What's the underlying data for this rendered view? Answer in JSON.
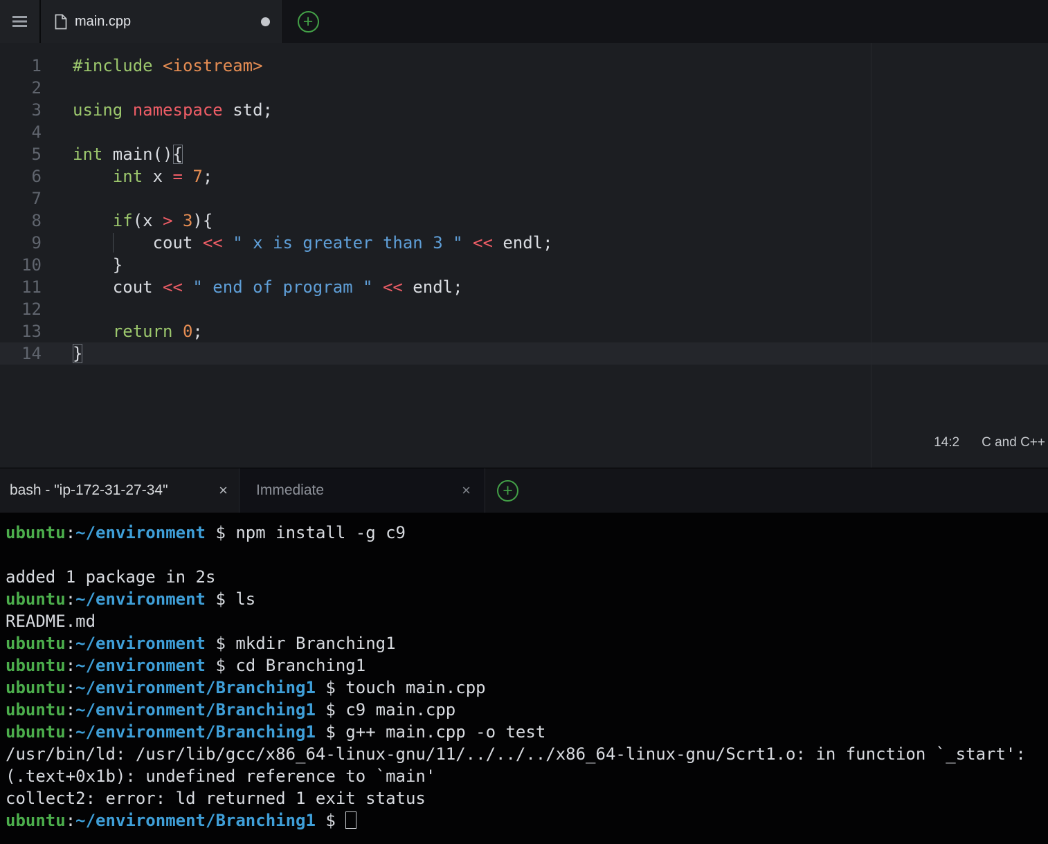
{
  "colors": {
    "accent_green": "#43a047",
    "keyword_green": "#9cc76d",
    "number_orange": "#e58d53",
    "operator_red": "#ee5d66",
    "string_blue": "#5f9fd8",
    "prompt_user_green": "#4cae4c",
    "prompt_path_blue": "#3f9fd8"
  },
  "icons": {
    "plus": "+",
    "close": "×"
  },
  "editor": {
    "tab_label": "main.cpp",
    "status_cursor": "14:2",
    "status_language": "C and C++"
  },
  "terminal_tabs": [
    {
      "label": "bash - \"ip-172-31-27-34\""
    },
    {
      "label": "Immediate"
    }
  ],
  "code_lines": [
    {
      "n": 1,
      "segs": [
        [
          "#include",
          "kw"
        ],
        [
          " ",
          "tx"
        ],
        [
          "<iostream>",
          "or"
        ]
      ]
    },
    {
      "n": 2,
      "segs": []
    },
    {
      "n": 3,
      "segs": [
        [
          "using",
          "kw"
        ],
        [
          " ",
          "tx"
        ],
        [
          "namespace",
          "rd"
        ],
        [
          " std;",
          "tx"
        ]
      ]
    },
    {
      "n": 4,
      "segs": []
    },
    {
      "n": 5,
      "segs": [
        [
          "int",
          "kw"
        ],
        [
          " main()",
          "tx"
        ],
        [
          "{",
          "tx mt"
        ]
      ]
    },
    {
      "n": 6,
      "segs": [
        [
          "    ",
          "tx"
        ],
        [
          "int",
          "kw"
        ],
        [
          " x ",
          "tx"
        ],
        [
          "=",
          "rd"
        ],
        [
          " ",
          "tx"
        ],
        [
          "7",
          "or"
        ],
        [
          ";",
          "tx"
        ]
      ]
    },
    {
      "n": 7,
      "segs": []
    },
    {
      "n": 8,
      "segs": [
        [
          "    ",
          "tx"
        ],
        [
          "if",
          "kw"
        ],
        [
          "(x ",
          "tx"
        ],
        [
          ">",
          "rd"
        ],
        [
          " ",
          "tx"
        ],
        [
          "3",
          "or"
        ],
        [
          "){",
          "tx"
        ]
      ]
    },
    {
      "n": 9,
      "guide": true,
      "segs": [
        [
          "        cout ",
          "tx"
        ],
        [
          "<<",
          "rd"
        ],
        [
          " ",
          "tx"
        ],
        [
          "\" x is greater than 3 \"",
          "st"
        ],
        [
          " ",
          "tx"
        ],
        [
          "<<",
          "rd"
        ],
        [
          " endl;",
          "tx"
        ]
      ]
    },
    {
      "n": 10,
      "segs": [
        [
          "    }",
          "tx"
        ]
      ]
    },
    {
      "n": 11,
      "segs": [
        [
          "    cout ",
          "tx"
        ],
        [
          "<<",
          "rd"
        ],
        [
          " ",
          "tx"
        ],
        [
          "\" end of program \"",
          "st"
        ],
        [
          " ",
          "tx"
        ],
        [
          "<<",
          "rd"
        ],
        [
          " endl;",
          "tx"
        ]
      ]
    },
    {
      "n": 12,
      "segs": []
    },
    {
      "n": 13,
      "segs": [
        [
          "    ",
          "tx"
        ],
        [
          "return",
          "kw"
        ],
        [
          " ",
          "tx"
        ],
        [
          "0",
          "or"
        ],
        [
          ";",
          "tx"
        ]
      ]
    },
    {
      "n": 14,
      "active": true,
      "segs": [
        [
          "}",
          "tx mt"
        ]
      ]
    }
  ],
  "terminal_lines": [
    {
      "segs": [
        [
          "ubuntu",
          "u"
        ],
        [
          ":",
          "tx"
        ],
        [
          "~/environment",
          "p"
        ],
        [
          " $ ",
          "tx"
        ],
        [
          "npm install -g c9",
          "tx"
        ]
      ]
    },
    {
      "segs": []
    },
    {
      "segs": [
        [
          "added 1 package in 2s",
          "tx"
        ]
      ]
    },
    {
      "segs": [
        [
          "ubuntu",
          "u"
        ],
        [
          ":",
          "tx"
        ],
        [
          "~/environment",
          "p"
        ],
        [
          " $ ",
          "tx"
        ],
        [
          "ls",
          "tx"
        ]
      ]
    },
    {
      "segs": [
        [
          "README.md",
          "tx"
        ]
      ]
    },
    {
      "segs": [
        [
          "ubuntu",
          "u"
        ],
        [
          ":",
          "tx"
        ],
        [
          "~/environment",
          "p"
        ],
        [
          " $ ",
          "tx"
        ],
        [
          "mkdir Branching1",
          "tx"
        ]
      ]
    },
    {
      "segs": [
        [
          "ubuntu",
          "u"
        ],
        [
          ":",
          "tx"
        ],
        [
          "~/environment",
          "p"
        ],
        [
          " $ ",
          "tx"
        ],
        [
          "cd Branching1",
          "tx"
        ]
      ]
    },
    {
      "segs": [
        [
          "ubuntu",
          "u"
        ],
        [
          ":",
          "tx"
        ],
        [
          "~/environment/Branching1",
          "p"
        ],
        [
          " $ ",
          "tx"
        ],
        [
          "touch main.cpp",
          "tx"
        ]
      ]
    },
    {
      "segs": [
        [
          "ubuntu",
          "u"
        ],
        [
          ":",
          "tx"
        ],
        [
          "~/environment/Branching1",
          "p"
        ],
        [
          " $ ",
          "tx"
        ],
        [
          "c9 main.cpp",
          "tx"
        ]
      ]
    },
    {
      "segs": [
        [
          "ubuntu",
          "u"
        ],
        [
          ":",
          "tx"
        ],
        [
          "~/environment/Branching1",
          "p"
        ],
        [
          " $ ",
          "tx"
        ],
        [
          "g++ main.cpp -o test",
          "tx"
        ]
      ]
    },
    {
      "segs": [
        [
          "/usr/bin/ld: /usr/lib/gcc/x86_64-linux-gnu/11/../../../x86_64-linux-gnu/Scrt1.o: in function `_start':",
          "tx"
        ]
      ]
    },
    {
      "segs": [
        [
          "(.text+0x1b): undefined reference to `main'",
          "tx"
        ]
      ]
    },
    {
      "segs": [
        [
          "collect2: error: ld returned 1 exit status",
          "tx"
        ]
      ]
    },
    {
      "segs": [
        [
          "ubuntu",
          "u"
        ],
        [
          ":",
          "tx"
        ],
        [
          "~/environment/Branching1",
          "p"
        ],
        [
          " $ ",
          "tx"
        ],
        [
          "",
          "cur"
        ]
      ]
    }
  ]
}
